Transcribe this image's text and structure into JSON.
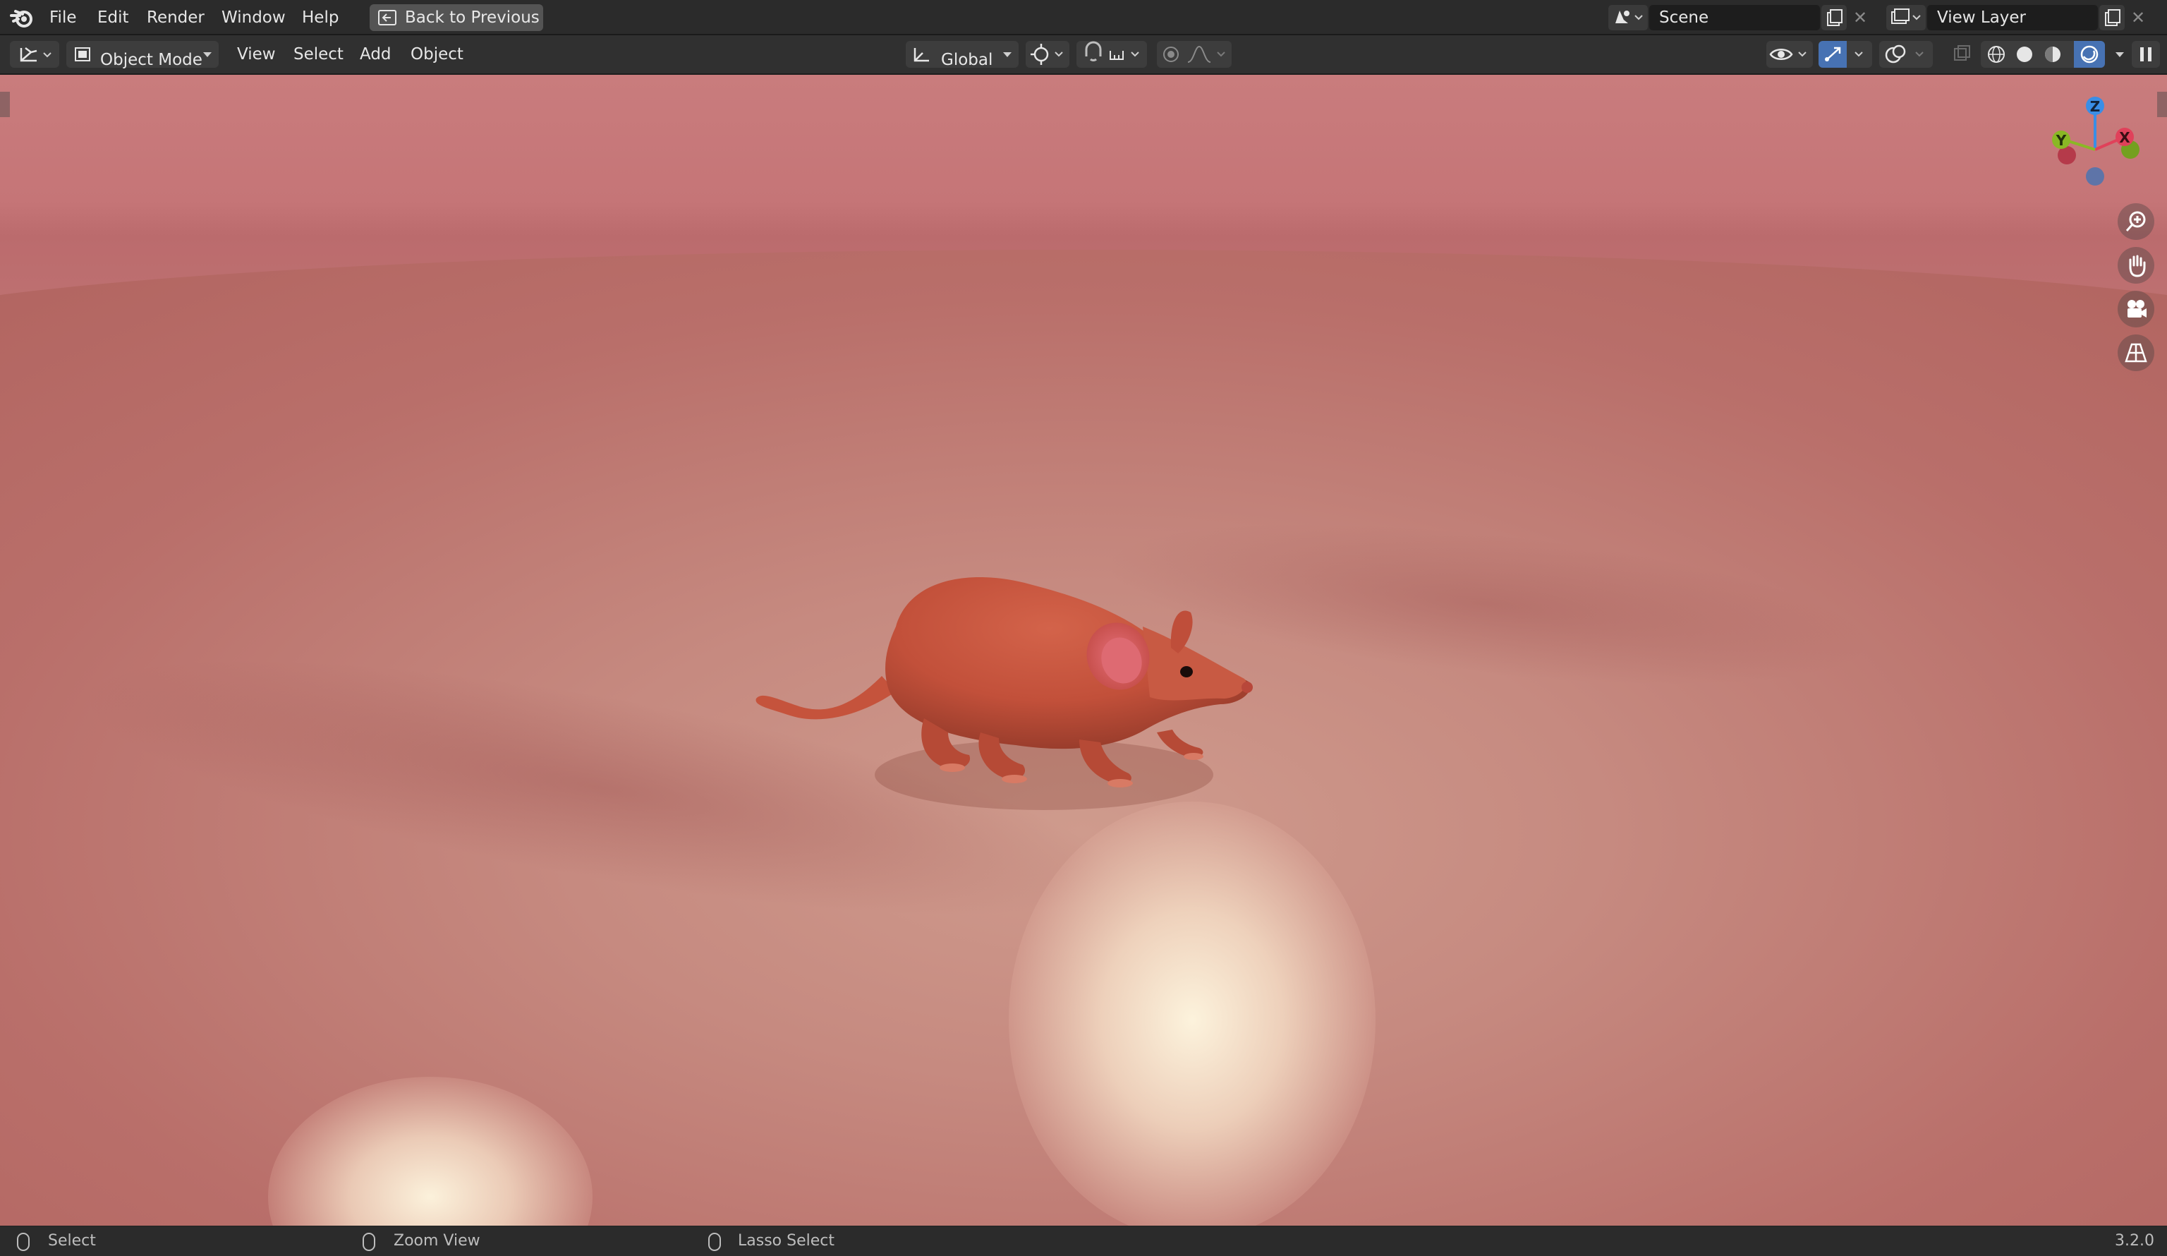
{
  "topbar": {
    "menu": [
      "File",
      "Edit",
      "Render",
      "Window",
      "Help"
    ],
    "back_button": "Back to Previous",
    "scene_name": "Scene",
    "view_layer_name": "View Layer",
    "icons": [
      "blender-logo-icon",
      "back-arrow-icon",
      "scene-icon",
      "new-scene-icon",
      "close-icon",
      "view-layer-icon",
      "new-view-layer-icon",
      "close-icon"
    ]
  },
  "header": {
    "editor_type_icon": "3d-viewport-icon",
    "mode": "Object Mode",
    "menus": [
      "View",
      "Select",
      "Add",
      "Object"
    ],
    "orientation": "Global",
    "pivot_icon": "pivot-icon",
    "snap_icon": "magnet-icon",
    "proportional_icon": "proportional-edit-icon",
    "shading_modes": [
      "wireframe",
      "solid",
      "material-preview",
      "rendered"
    ],
    "active_shading": "rendered",
    "accent_color": "#4772b3"
  },
  "viewport": {
    "gizmo_axes": [
      "Z",
      "X",
      "Y"
    ],
    "axis_colors": {
      "x": "#e0415a",
      "y": "#8ab825",
      "z": "#3a8ee6"
    },
    "nav_buttons": [
      "zoom-icon",
      "pan-hand-icon",
      "camera-icon",
      "grid-perspective-icon"
    ]
  },
  "statusbar": {
    "left_click": "Select",
    "middle_click": "Zoom View",
    "right_click": "Lasso Select",
    "version": "3.2.0"
  }
}
